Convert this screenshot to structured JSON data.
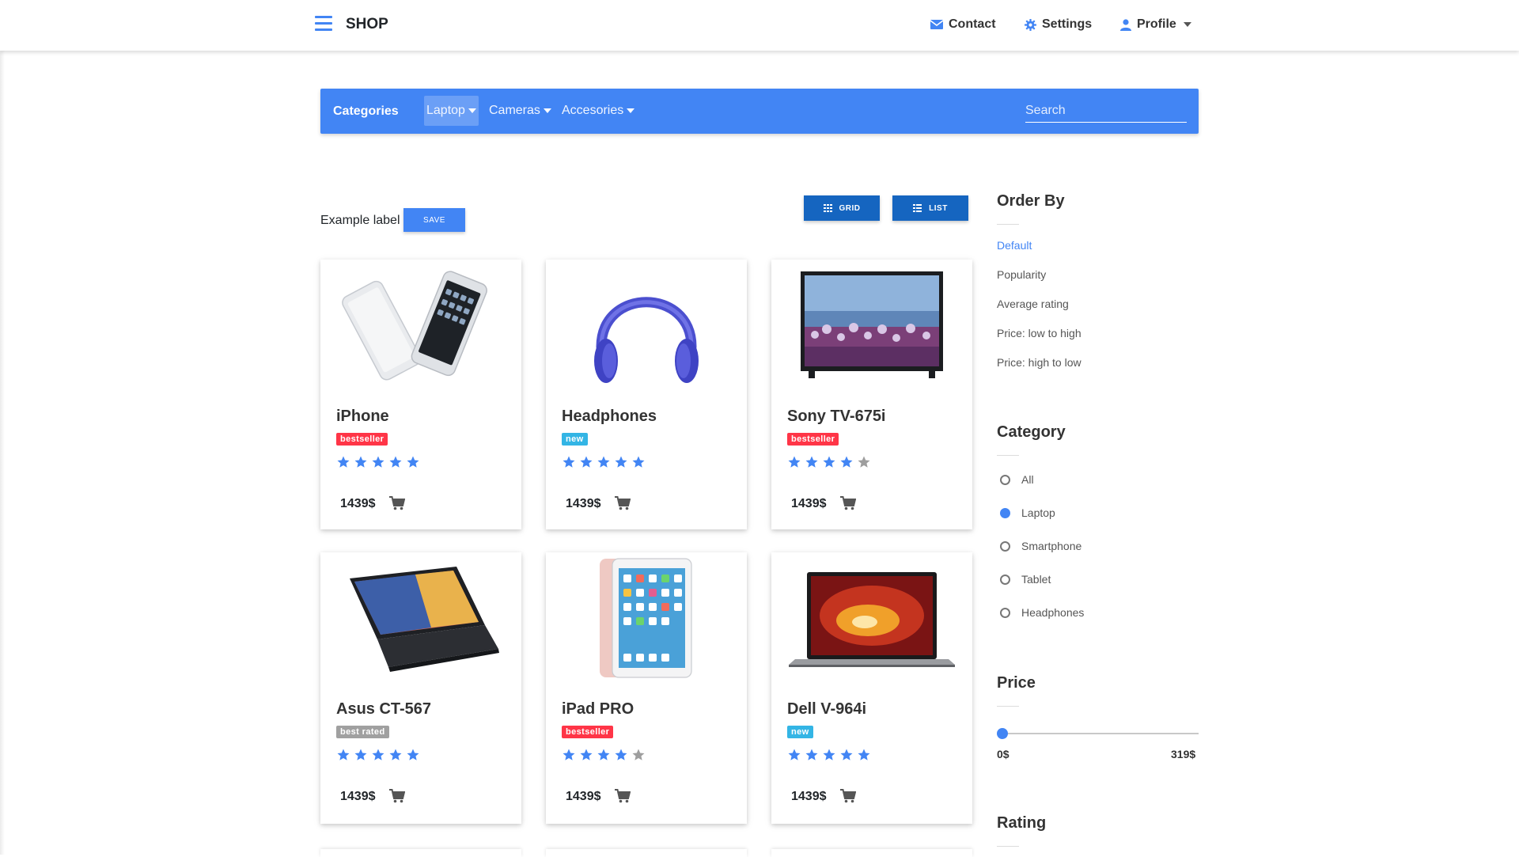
{
  "nav": {
    "brand": "SHOP",
    "contact": "Contact",
    "settings": "Settings",
    "profile": "Profile"
  },
  "categories": {
    "title": "Categories",
    "items": [
      {
        "label": "Laptop",
        "active": true
      },
      {
        "label": "Cameras",
        "active": false
      },
      {
        "label": "Accesories",
        "active": false
      }
    ],
    "search_placeholder": "Search"
  },
  "toolbar": {
    "example_label": "Example label",
    "save": "SAVE",
    "grid": "GRID",
    "list": "LIST"
  },
  "products": [
    {
      "name": "iPhone",
      "badge": "bestseller",
      "rating": 5,
      "price": "1439$"
    },
    {
      "name": "Headphones",
      "badge": "new",
      "rating": 5,
      "price": "1439$"
    },
    {
      "name": "Sony TV-675i",
      "badge": "bestseller",
      "rating": 4,
      "price": "1439$"
    },
    {
      "name": "Asus CT-567",
      "badge": "best rated",
      "rating": 5,
      "price": "1439$"
    },
    {
      "name": "iPad PRO",
      "badge": "bestseller",
      "rating": 4,
      "price": "1439$"
    },
    {
      "name": "Dell V-964i",
      "badge": "new",
      "rating": 5,
      "price": "1439$"
    }
  ],
  "sidebar": {
    "order_by": {
      "title": "Order By",
      "options": [
        "Default",
        "Popularity",
        "Average rating",
        "Price: low to high",
        "Price: high to low"
      ],
      "selected": "Default"
    },
    "category": {
      "title": "Category",
      "options": [
        "All",
        "Laptop",
        "Smartphone",
        "Tablet",
        "Headphones"
      ],
      "selected": "Laptop"
    },
    "price": {
      "title": "Price",
      "min_label": "0$",
      "max_label": "319$",
      "value": 0
    },
    "rating": {
      "title": "Rating"
    }
  },
  "colors": {
    "primary": "#4285f4",
    "dark_button": "#1565c0",
    "bestseller": "#ff3547",
    "new": "#33b5e5",
    "best_rated": "#a0a0a0",
    "star": "#4285f4"
  }
}
